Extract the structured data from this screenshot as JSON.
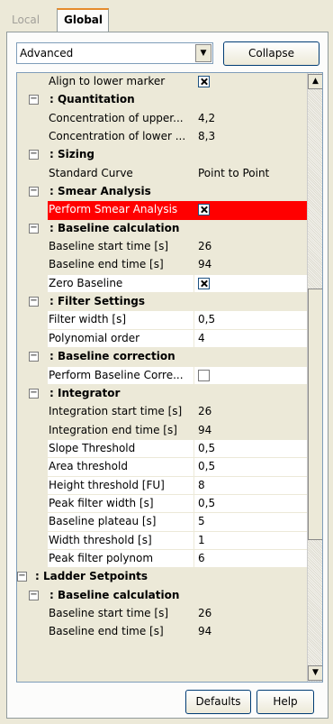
{
  "tabs": {
    "local": "Local",
    "global": "Global"
  },
  "dropdown": {
    "value": "Advanced",
    "arrow": "▼"
  },
  "buttons": {
    "collapse": "Collapse",
    "defaults": "Defaults",
    "help": "Help"
  },
  "rows": [
    {
      "type": "prop",
      "style": "plain",
      "label": "Align to lower marker",
      "check": "on"
    },
    {
      "type": "cat",
      "level": 1,
      "label": ": Quantitation"
    },
    {
      "type": "prop",
      "style": "plain",
      "label": "Concentration of upper...",
      "value": "4,2"
    },
    {
      "type": "prop",
      "style": "plain",
      "label": "Concentration of lower ...",
      "value": "8,3"
    },
    {
      "type": "cat",
      "level": 1,
      "label": ": Sizing"
    },
    {
      "type": "prop",
      "style": "plain",
      "label": "Standard Curve",
      "value": "Point to Point"
    },
    {
      "type": "cat",
      "level": 1,
      "label": ": Smear Analysis"
    },
    {
      "type": "prop",
      "style": "red",
      "label": "Perform Smear Analysis",
      "check": "on"
    },
    {
      "type": "cat",
      "level": 1,
      "label": ": Baseline calculation"
    },
    {
      "type": "prop",
      "style": "plain",
      "label": "Baseline start time [s]",
      "value": "26"
    },
    {
      "type": "prop",
      "style": "plain",
      "label": "Baseline end time [s]",
      "value": "94"
    },
    {
      "type": "prop",
      "style": "white",
      "label": "Zero Baseline",
      "check": "on"
    },
    {
      "type": "cat",
      "level": 1,
      "label": ": Filter Settings"
    },
    {
      "type": "prop",
      "style": "white",
      "label": "Filter width [s]",
      "value": "0,5"
    },
    {
      "type": "prop",
      "style": "white",
      "label": "Polynomial order",
      "value": "4"
    },
    {
      "type": "cat",
      "level": 1,
      "label": ": Baseline correction"
    },
    {
      "type": "prop",
      "style": "white",
      "label": "Perform Baseline Corre...",
      "check": "off"
    },
    {
      "type": "cat",
      "level": 1,
      "label": ": Integrator"
    },
    {
      "type": "prop",
      "style": "plain",
      "label": "Integration start time [s]",
      "value": "26"
    },
    {
      "type": "prop",
      "style": "plain",
      "label": "Integration end time [s]",
      "value": "94"
    },
    {
      "type": "prop",
      "style": "white",
      "label": "Slope Threshold",
      "value": "0,5"
    },
    {
      "type": "prop",
      "style": "white",
      "label": "Area threshold",
      "value": "0,5"
    },
    {
      "type": "prop",
      "style": "white",
      "label": "Height threshold [FU]",
      "value": "8"
    },
    {
      "type": "prop",
      "style": "white",
      "label": "Peak filter width [s]",
      "value": "0,5"
    },
    {
      "type": "prop",
      "style": "white",
      "label": "Baseline plateau [s]",
      "value": "5"
    },
    {
      "type": "prop",
      "style": "white",
      "label": "Width threshold [s]",
      "value": "1"
    },
    {
      "type": "prop",
      "style": "white",
      "label": "Peak filter polynom",
      "value": "6"
    },
    {
      "type": "cat",
      "level": 0,
      "label": ": Ladder Setpoints"
    },
    {
      "type": "cat",
      "level": 1,
      "label": ": Baseline calculation"
    },
    {
      "type": "prop",
      "style": "plain",
      "label": "Baseline start time [s]",
      "value": "26"
    },
    {
      "type": "prop",
      "style": "plain",
      "label": "Baseline end time [s]",
      "value": "94"
    }
  ],
  "scrollbar": {
    "up": "▲",
    "down": "▼"
  },
  "icons": {
    "expander": "minus-box-icon",
    "checkbox": "checkbox-icon"
  }
}
